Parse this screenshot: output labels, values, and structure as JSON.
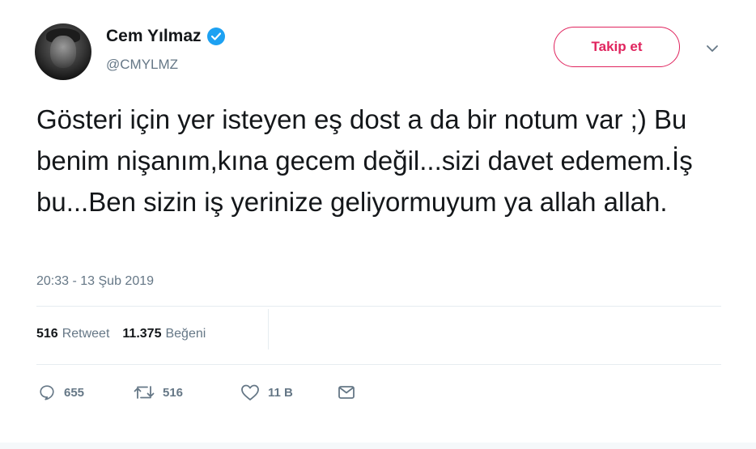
{
  "user": {
    "name": "Cem Yılmaz",
    "handle": "@CMYLMZ",
    "verified": true,
    "avatar_icon": "avatar"
  },
  "follow_button": {
    "label": "Takip et",
    "color": "#e0245e"
  },
  "tweet": {
    "text": "Gösteri için yer isteyen eş dost a da bir notum var ;) Bu benim nişanım,kına gecem değil...sizi davet edemem.İş bu...Ben sizin iş yerinize geliyormuyum ya allah allah.",
    "timestamp": "20:33 - 13 Şub 2019"
  },
  "stats": {
    "retweets": {
      "count": "516",
      "label": "Retweet"
    },
    "likes": {
      "count": "11.375",
      "label": "Beğeni"
    }
  },
  "actions": {
    "reply": {
      "icon": "reply-icon",
      "count": "655"
    },
    "retweet": {
      "icon": "retweet-icon",
      "count": "516"
    },
    "like": {
      "icon": "heart-icon",
      "count": "11 B"
    },
    "message": {
      "icon": "envelope-icon"
    }
  },
  "colors": {
    "verified": "#1da1f2",
    "secondary_text": "#657786",
    "divider": "#e6ecf0"
  }
}
